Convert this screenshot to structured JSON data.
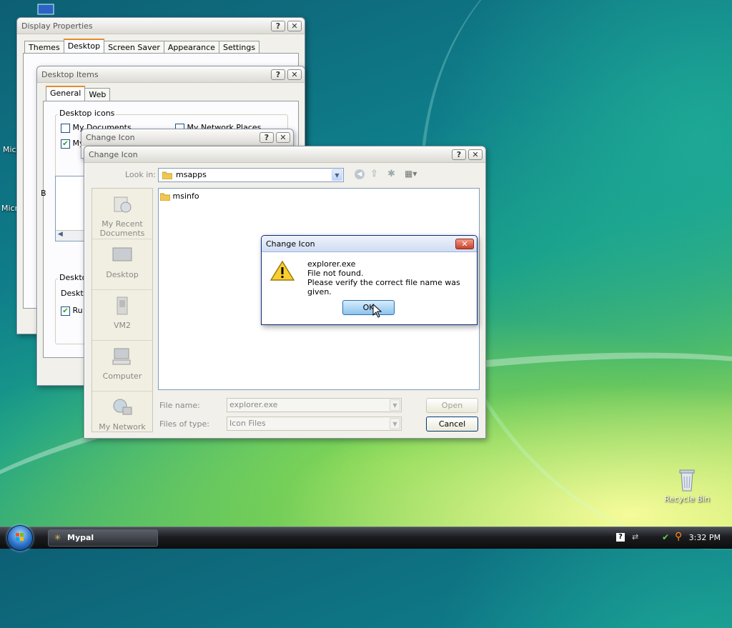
{
  "desktop": {
    "left_icon_frag_1": "Mic",
    "left_icon_frag_2": "Micr",
    "recycle_bin": "Recycle Bin"
  },
  "display_properties": {
    "title": "Display Properties",
    "tabs": [
      "Themes",
      "Desktop",
      "Screen Saver",
      "Appearance",
      "Settings"
    ]
  },
  "desktop_items": {
    "title": "Desktop Items",
    "tabs": [
      "General",
      "Web"
    ],
    "group_title": "Desktop icons",
    "check1": "My Documents",
    "check2": "My Network Places",
    "check3_frag": "My",
    "section_frag_1": "B",
    "section_frag_2": "Deskto",
    "section_frag_3": "Deskto",
    "run_frag": "Ru"
  },
  "change_icon_back": {
    "title": "Change Icon"
  },
  "change_icon": {
    "title": "Change Icon",
    "look_in_label": "Look in:",
    "look_in_value": "msapps",
    "files": [
      "msinfo"
    ],
    "places": [
      "My Recent Documents",
      "Desktop",
      "VM2",
      "Computer",
      "My Network"
    ],
    "file_name_label": "File name:",
    "file_name_value": "explorer.exe",
    "files_of_type_label": "Files of type:",
    "files_of_type_value": "Icon Files",
    "open_label": "Open",
    "cancel_label": "Cancel"
  },
  "alert": {
    "title": "Change Icon",
    "line1": "explorer.exe",
    "line2": "File not found.",
    "line3": "Please verify the correct file name was given.",
    "ok_label": "OK"
  },
  "taskbar": {
    "task_label": "Mypal",
    "clock": "3:32 PM"
  }
}
